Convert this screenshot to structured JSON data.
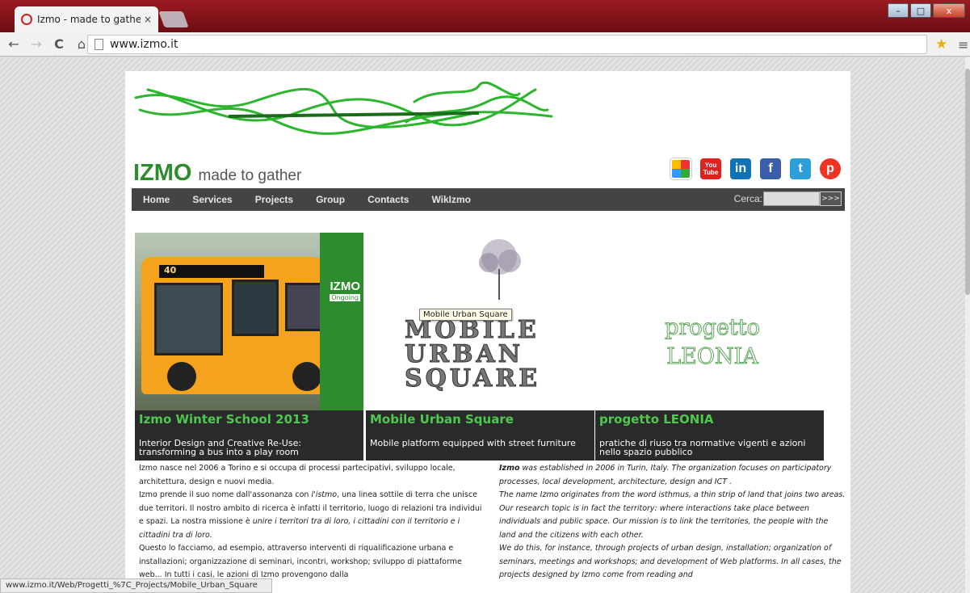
{
  "browser": {
    "tab_title": "Izmo - made to gather - Iz",
    "tab_close": "×",
    "url": "www.izmo.it",
    "status_url": "www.izmo.it/Web/Progetti_%7C_Projects/Mobile_Urban_Square",
    "controls": {
      "minimize": "–",
      "maximize": "□",
      "close": "x"
    }
  },
  "header": {
    "brand_name": "IZMO",
    "brand_tagline": "made to gather",
    "brand_color": "#2e8b2e",
    "social_icons": [
      "picasa-icon",
      "youtube-icon",
      "linkedin-icon",
      "facebook-icon",
      "twitter-icon",
      "pinterest-icon"
    ],
    "social_labels": {
      "youtube_top": "You",
      "youtube_bottom": "Tube",
      "linkedin": "in",
      "facebook": "f",
      "twitter": "t",
      "pinterest": "p"
    }
  },
  "nav": {
    "items": [
      "Home",
      "Services",
      "Projects",
      "Group",
      "Contacts",
      "WikIzmo"
    ],
    "search_label": "Cerca:",
    "search_button": ">>>"
  },
  "cards": [
    {
      "title": "Izmo Winter School 2013",
      "text": "Interior Design and Creative Re-Use: transforming a bus into a play room",
      "badge": "IZMO",
      "badge_sub": "Ongoing",
      "bus_sign": "40"
    },
    {
      "title": "Mobile Urban Square",
      "text": "Mobile platform equipped with street furniture",
      "words": [
        "MOBILE",
        "URBAN",
        "SQUARE"
      ],
      "tooltip": "Mobile Urban Square"
    },
    {
      "title": "progetto LEONIA",
      "text": "pratiche di riuso tra normative vigenti e azioni nello spazio pubblico",
      "logo_line1": "progetto",
      "logo_line2": "LEONIA"
    }
  ],
  "text_it": {
    "p1": "Izmo nasce nel 2006 a Torino e si occupa di processi partecipativi, sviluppo locale, architettura, design e nuovi media.",
    "p2a": "Izmo prende il suo nome dall'assonanza con ",
    "p2b": "l'istmo",
    "p2c": ", una linea sottile di terra che unisce due territori. Il nostro ambito di ricerca è infatti il territorio, luogo di relazioni tra individui e spazi. La nostra missione è ",
    "p2d": "unire i territori tra di loro, i cittadini con il territorio e i cittadini tra di loro.",
    "p3": "Questo lo facciamo, ad esempio, attraverso interventi di riqualificazione urbana e installazioni; organizzazione di seminari, incontri, workshop; sviluppo di piattaforme web... In tutti i casi, le azioni di Izmo provengono dalla"
  },
  "text_en": {
    "p1a": "Izmo",
    "p1b": " was established in 2006 in Turin, Italy. The organization focuses on participatory processes, local development, architecture, design and ICT .",
    "p2": "The name Izmo originates from the word isthmus, a thin strip of land that joins two areas. Our research topic is in fact the territory: where interactions take place between individuals and public space. Our mission is to link the territories, the people with the land and the citizens with each other.",
    "p3": "We do this, for instance, through projects of urban design, installation; organization of seminars, meetings and workshops; and development of Web platforms. In all cases, the projects designed by Izmo come from reading and"
  }
}
